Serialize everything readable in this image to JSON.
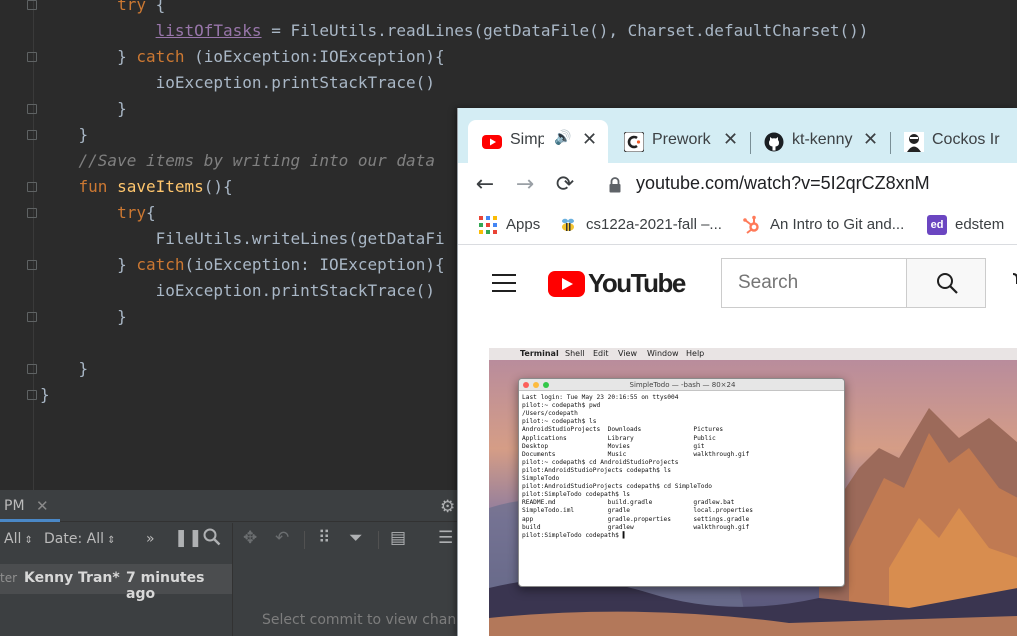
{
  "editor": {
    "lines": [
      {
        "segments": [
          {
            "t": "        "
          },
          {
            "t": "try",
            "c": "kw"
          },
          {
            "t": " {"
          }
        ]
      },
      {
        "segments": [
          {
            "t": "            "
          },
          {
            "t": "listOfTasks",
            "c": "pv"
          },
          {
            "t": " = FileUtils.readLines(getDataFile(), Charset.defaultCharset())"
          }
        ]
      },
      {
        "segments": [
          {
            "t": "        } "
          },
          {
            "t": "catch",
            "c": "kw"
          },
          {
            "t": " (ioException:IOException){"
          }
        ]
      },
      {
        "segments": [
          {
            "t": "            ioException.printStackTrace()"
          }
        ]
      },
      {
        "segments": [
          {
            "t": "        }"
          }
        ]
      },
      {
        "segments": [
          {
            "t": "    }"
          }
        ]
      },
      {
        "segments": [
          {
            "t": "    "
          },
          {
            "t": "//Save items by writing into our data",
            "c": "cm"
          }
        ]
      },
      {
        "segments": [
          {
            "t": "    "
          },
          {
            "t": "fun",
            "c": "kw"
          },
          {
            "t": " "
          },
          {
            "t": "saveItems",
            "c": "fn"
          },
          {
            "t": "(){"
          }
        ]
      },
      {
        "segments": [
          {
            "t": "        "
          },
          {
            "t": "try",
            "c": "kw"
          },
          {
            "t": "{"
          }
        ]
      },
      {
        "segments": [
          {
            "t": "            FileUtils.writeLines(getDataFi"
          }
        ]
      },
      {
        "segments": [
          {
            "t": "        } "
          },
          {
            "t": "catch",
            "c": "kw"
          },
          {
            "t": "(ioException: IOException){"
          }
        ]
      },
      {
        "segments": [
          {
            "t": "            ioException.printStackTrace()"
          }
        ]
      },
      {
        "segments": [
          {
            "t": "        }"
          }
        ]
      },
      {
        "segments": [
          {
            "t": ""
          }
        ]
      },
      {
        "segments": [
          {
            "t": "    }"
          }
        ]
      },
      {
        "segments": [
          {
            "t": "}"
          }
        ]
      }
    ]
  },
  "git_panel": {
    "tab_label": "PM",
    "tab_close": "✕",
    "filter_all": "All",
    "filter_date": "Date: All",
    "more": "»",
    "commit": {
      "branch": "ter",
      "author": "Kenny Tran*",
      "time": "7 minutes ago"
    },
    "hint": "Select commit to view changes"
  },
  "browser": {
    "tabs": [
      {
        "title": "Simp",
        "icon": "youtube-icon",
        "active": true,
        "audio": "🔊"
      },
      {
        "title": "Prework",
        "icon": "codepath-icon",
        "active": false
      },
      {
        "title": "kt-kenny",
        "icon": "github-icon",
        "active": false
      },
      {
        "title": "Cockos Ir",
        "icon": "cockos-icon",
        "active": false
      }
    ],
    "tab_close": "✕",
    "url": "youtube.com/watch?v=5I2qrCZ8xnM",
    "bookmarks": [
      {
        "label": "Apps",
        "icon": "apps-grid-icon"
      },
      {
        "label": "cs122a-2021-fall –...",
        "icon": "bee-icon"
      },
      {
        "label": "An Intro to Git and...",
        "icon": "hubspot-icon"
      },
      {
        "label": "edstem",
        "icon": "edstem-icon"
      }
    ],
    "edstem_badge": "ed"
  },
  "youtube": {
    "logo_text": "YouTube",
    "search_placeholder": "Search"
  },
  "video": {
    "menubar": [
      "Terminal",
      "Shell",
      "Edit",
      "View",
      "Window",
      "Help"
    ],
    "terminal_title": "SimpleTodo — -bash — 80×24",
    "terminal_lines": [
      "Last login: Tue May 23 20:16:55 on ttys004",
      "pilot:~ codepath$ pwd",
      "/Users/codepath",
      "pilot:~ codepath$ ls",
      "AndroidStudioProjects  Downloads              Pictures",
      "Applications           Library                Public",
      "Desktop                Movies                 git",
      "Documents              Music                  walkthrough.gif",
      "pilot:~ codepath$ cd AndroidStudioProjects",
      "pilot:AndroidStudioProjects codepath$ ls",
      "SimpleTodo",
      "pilot:AndroidStudioProjects codepath$ cd SimpleTodo",
      "pilot:SimpleTodo codepath$ ls",
      "README.md              build.gradle           gradlew.bat",
      "SimpleTodo.iml         gradle                 local.properties",
      "app                    gradle.properties      settings.gradle",
      "build                  gradlew                walkthrough.gif",
      "pilot:SimpleTodo codepath$ ▌"
    ]
  }
}
